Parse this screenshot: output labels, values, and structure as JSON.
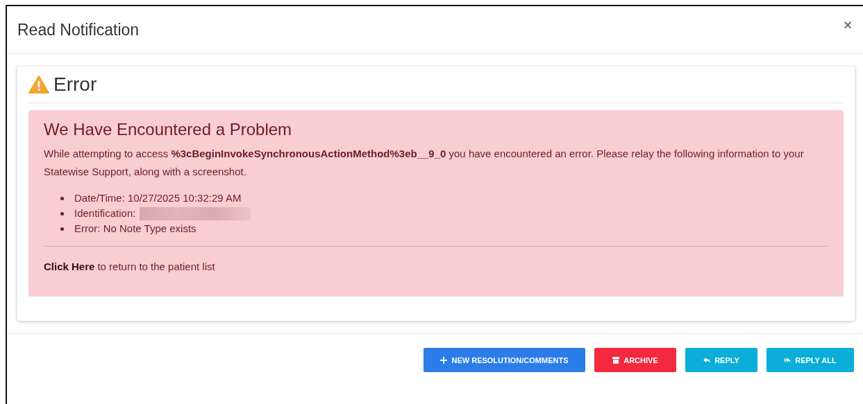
{
  "window": {
    "title": "Read Notification",
    "close": "×"
  },
  "card": {
    "title": "Error"
  },
  "alert": {
    "heading": "We Have Encountered a Problem",
    "message": "While attempting to access **%3cBeginInvokeSynchronousActionMethod%3eb__9_0** you have encountered an error. Please relay the following information to your Statewise Support, along with a screenshot.",
    "details": [
      {
        "kind": "text",
        "label": "Date/Time: 10/27/2025 10:32:29 AM"
      },
      {
        "kind": "redacted",
        "label": "Identification:"
      },
      {
        "kind": "text",
        "label": "Error: No Note Type exists"
      }
    ],
    "link": "Click Here",
    "link_suffix": "to return to the patient list"
  },
  "buttons": [
    {
      "kind": "new",
      "label": "NEW RESOLUTION/COMMENTS"
    },
    {
      "kind": "archive",
      "label": "ARCHIVE"
    },
    {
      "kind": "reply",
      "label": "REPLY"
    },
    {
      "kind": "reply_all",
      "label": "REPLY ALL"
    }
  ]
}
